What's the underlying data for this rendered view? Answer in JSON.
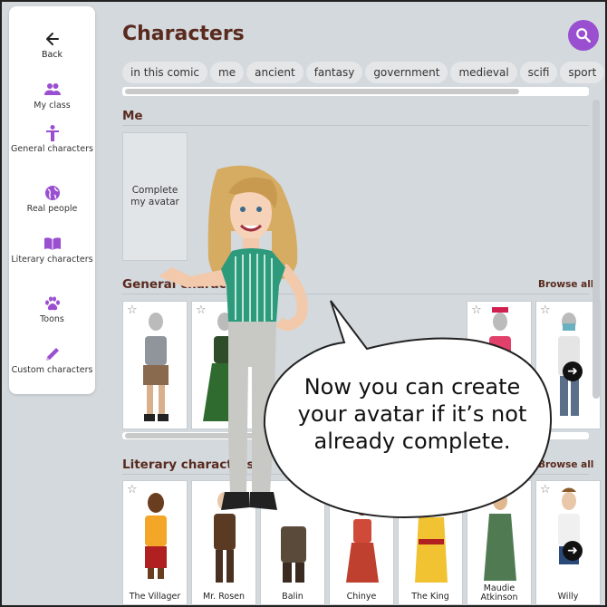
{
  "sidebar": {
    "items": [
      {
        "label": "Back",
        "icon": "arrow-left-icon"
      },
      {
        "label": "My class",
        "icon": "group-icon"
      },
      {
        "label": "General characters",
        "icon": "person-icon"
      },
      {
        "label": "Real people",
        "icon": "globe-icon"
      },
      {
        "label": "Literary characters",
        "icon": "book-icon"
      },
      {
        "label": "Toons",
        "icon": "paw-icon"
      },
      {
        "label": "Custom characters",
        "icon": "pencil-icon"
      }
    ]
  },
  "header": {
    "title": "Characters"
  },
  "tags": [
    "in this comic",
    "me",
    "ancient",
    "fantasy",
    "government",
    "medieval",
    "scifi",
    "sport"
  ],
  "me_section": {
    "title": "Me",
    "card_label": "Complete my avatar"
  },
  "general_section": {
    "title": "General characters",
    "browse_label": "Browse all"
  },
  "literary_section": {
    "title": "Literary characters",
    "browse_label": "Browse all",
    "cards": [
      "The Villager",
      "Mr. Rosen",
      "Balin",
      "Chinye",
      "The King",
      "Maudie Atkinson",
      "Willy"
    ]
  },
  "speech_bubble": {
    "text": "Now you can create your avatar if it’s not already complete."
  },
  "colors": {
    "accent": "#9a4fd1",
    "heading": "#5a2a1e",
    "background": "#d3d9dd"
  }
}
